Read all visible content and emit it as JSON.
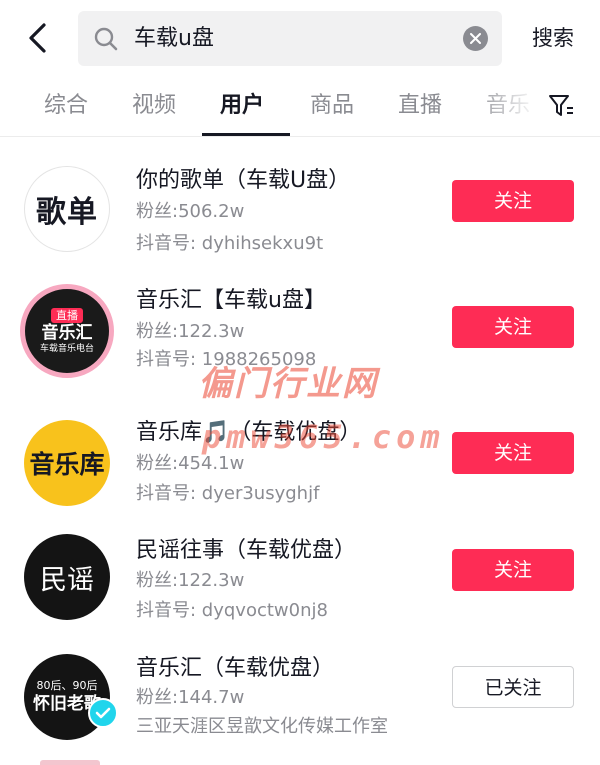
{
  "search": {
    "query": "车载u盘",
    "submit_label": "搜索"
  },
  "tabs": [
    {
      "label": "综合"
    },
    {
      "label": "视频"
    },
    {
      "label": "用户"
    },
    {
      "label": "商品"
    },
    {
      "label": "直播"
    },
    {
      "label": "音乐"
    }
  ],
  "active_tab": "用户",
  "users": [
    {
      "name": "你的歌单（车载U盘）",
      "fans": "粉丝:506.2w",
      "sub": "抖音号: dyhihsekxu9t",
      "button": "关注",
      "avatar_text": "歌单"
    },
    {
      "name": "音乐汇【车载u盘】",
      "fans": "粉丝:122.3w",
      "sub": "抖音号: 1988265098",
      "button": "关注",
      "avatar_badge": "直播",
      "avatar_text": "音乐汇",
      "avatar_caption": "车载音乐电台"
    },
    {
      "name": "音乐库🎵（车载优盘）",
      "fans": "粉丝:454.1w",
      "sub": "抖音号: dyer3usyghjf",
      "button": "关注",
      "avatar_text": "音乐库"
    },
    {
      "name": "民谣往事（车载优盘）",
      "fans": "粉丝:122.3w",
      "sub": "抖音号: dyqvoctw0nj8",
      "button": "关注",
      "avatar_text": "民谣"
    },
    {
      "name": "音乐汇（车载优盘）",
      "fans": "粉丝:144.7w",
      "sub": "三亚天涯区昱歆文化传媒工作室",
      "button": "已关注",
      "avatar_caption": "80后、90后",
      "avatar_text": "怀旧老歌",
      "verified": true
    }
  ],
  "watermark": {
    "line1": "偏门行业网",
    "line2": "pmw365.com"
  },
  "colors": {
    "accent": "#fe2c55",
    "muted": "#8a8b91",
    "text": "#161823",
    "verified": "#20d5ec"
  },
  "icons": [
    "back-arrow-icon",
    "search-icon",
    "clear-icon",
    "filter-icon",
    "music-note-icon",
    "verified-check-icon"
  ]
}
